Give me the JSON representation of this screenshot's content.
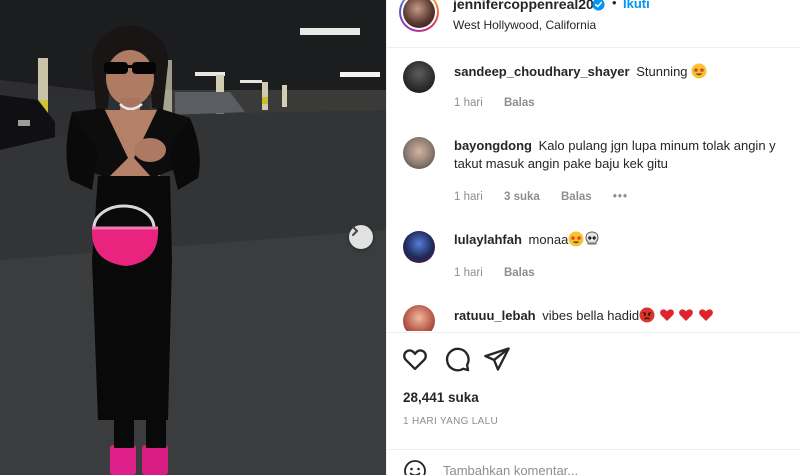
{
  "post": {
    "username": "jennifercoppenreal20",
    "follow_label": "Ikuti",
    "location": "West Hollywood, California",
    "likes": "28,441 suka",
    "time_ago": "1 HARI YANG LALU",
    "comment_placeholder": "Tambahkan komentar..."
  },
  "comments": [
    {
      "username": "sandeep_choudhary_shayer",
      "text": "Stunning",
      "emojis": [
        "star-struck"
      ],
      "time": "1 hari",
      "likes": "",
      "reply": "Balas",
      "avatar_color": "#2b2b2b"
    },
    {
      "username": "bayongdong",
      "text": "Kalo pulang jgn lupa minum tolak angin y",
      "text_line2": "takut masuk angin pake baju kek gitu",
      "emojis": [],
      "time": "1 hari",
      "likes": "3 suka",
      "reply": "Balas",
      "avatar_color": "#8a7a72"
    },
    {
      "username": "lulaylahfah",
      "text": "monaa",
      "emojis": [
        "star-struck",
        "skull"
      ],
      "time": "1 hari",
      "likes": "",
      "reply": "Balas",
      "avatar_color": "#1d2a5a"
    },
    {
      "username": "ratuuu_lebah",
      "text": "vibes bella hadid",
      "emojis": [
        "angry-face",
        "red-heart",
        "red-heart",
        "red-heart"
      ],
      "time": "",
      "likes": "",
      "reply": "",
      "avatar_color": "#b85a4a"
    }
  ],
  "colors": {
    "accent": "#0095f6",
    "text": "#262626",
    "muted": "#8e8e8e",
    "handbag": "#e8247f",
    "shoes": "#e0208a"
  },
  "icons": [
    "verified-badge-icon",
    "heart-icon",
    "comment-icon",
    "share-icon",
    "emoji-icon",
    "next-arrow-icon",
    "more-dots-icon"
  ]
}
